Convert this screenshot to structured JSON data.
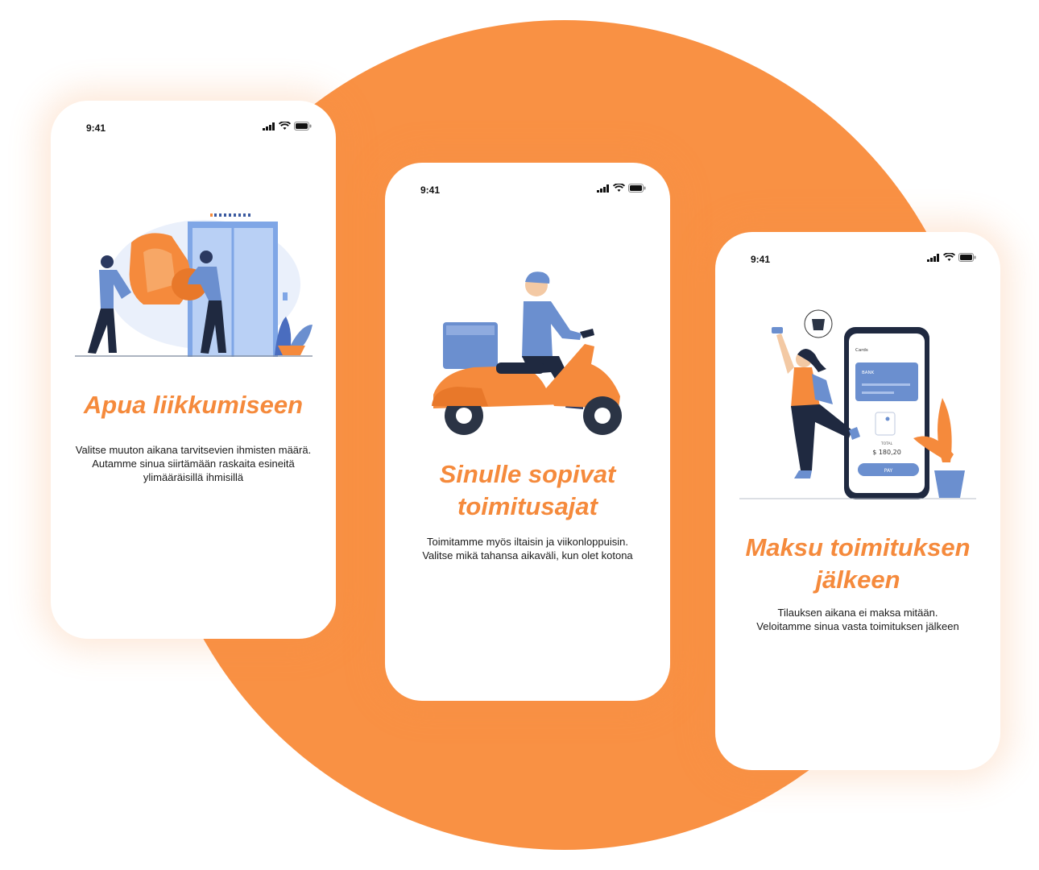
{
  "colors": {
    "accent": "#f58a3c",
    "circle": "#f99144",
    "illustration_blue": "#6b8fcf"
  },
  "screens": [
    {
      "time": "9:41",
      "illustration": "movers-carrying-armchair",
      "title": "Apua liikkumiseen",
      "description_lines": [
        "Valitse muuton aikana tarvitsevien ihmisten määrä.",
        "Autamme sinua siirtämään raskaita esineitä",
        "ylimääräisillä ihmisillä"
      ]
    },
    {
      "time": "9:41",
      "illustration": "courier-on-scooter",
      "title_lines": [
        "Sinulle sopivat",
        "toimitusajat"
      ],
      "description_lines": [
        "Toimitamme myös iltaisin ja viikonloppuisin.",
        "Valitse mikä tahansa aikaväli, kun olet kotona"
      ]
    },
    {
      "time": "9:41",
      "illustration": "woman-paying-with-phone",
      "title_lines": [
        "Maksu toimituksen",
        "jälkeen"
      ],
      "description_lines": [
        "Tilauksen aikana ei maksa mitään.",
        "Veloitamme sinua vasta toimituksen jälkeen"
      ],
      "phone_mock": {
        "header": "Cards",
        "card_label": "BANK",
        "total_label": "TOTAL",
        "total_amount": "$ 180,20",
        "pay_button": "PAY"
      }
    }
  ]
}
